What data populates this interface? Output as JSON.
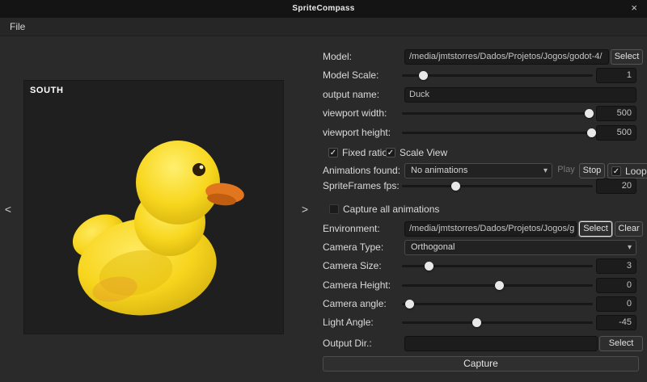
{
  "window": {
    "title": "SpriteCompass",
    "menu": {
      "file": "File"
    }
  },
  "icons": {
    "close": "×",
    "check": "✓",
    "chevron": "▾"
  },
  "viewport": {
    "direction": "SOUTH",
    "prev": "<",
    "next": ">"
  },
  "form": {
    "model": {
      "label": "Model:",
      "value": "/media/jmtstorres/Dados/Projetos/Jogos/godot-4/",
      "select": "Select"
    },
    "model_scale": {
      "label": "Model Scale:",
      "value": "1"
    },
    "output_name": {
      "label": "output name:",
      "value": "Duck"
    },
    "viewport_width": {
      "label": "viewport width:",
      "value": "500"
    },
    "viewport_height": {
      "label": "viewport height:",
      "value": "500"
    },
    "fixed_ratio": {
      "label": "Fixed ratio",
      "checked": true
    },
    "scale_view": {
      "label": "Scale View",
      "checked": true
    },
    "animations": {
      "label": "Animations found:",
      "selected": "No animations",
      "play": "Play",
      "stop": "Stop",
      "loop": "Loop",
      "loop_checked": true
    },
    "fps": {
      "label": "SpriteFrames fps:",
      "value": "20"
    },
    "capture_all": {
      "label": "Capture all animations",
      "checked": false
    },
    "environment": {
      "label": "Environment:",
      "value": "/media/jmtstorres/Dados/Projetos/Jogos/g",
      "select": "Select",
      "clear": "Clear"
    },
    "camera_type": {
      "label": "Camera Type:",
      "selected": "Orthogonal"
    },
    "camera_size": {
      "label": "Camera Size:",
      "value": "3"
    },
    "camera_height": {
      "label": "Camera Height:",
      "value": "0"
    },
    "camera_angle": {
      "label": "Camera angle:",
      "value": "0"
    },
    "light_angle": {
      "label": "Light Angle:",
      "value": "-45"
    },
    "output_dir": {
      "label": "Output Dir.:",
      "value": "",
      "select": "Select"
    },
    "capture": {
      "label": "Capture"
    }
  },
  "colors": {
    "duck_body": "#f7d51e",
    "duck_beak": "#e2761f",
    "viewport_bg": "#1f1f1f",
    "titlebar_bg": "#141414"
  }
}
